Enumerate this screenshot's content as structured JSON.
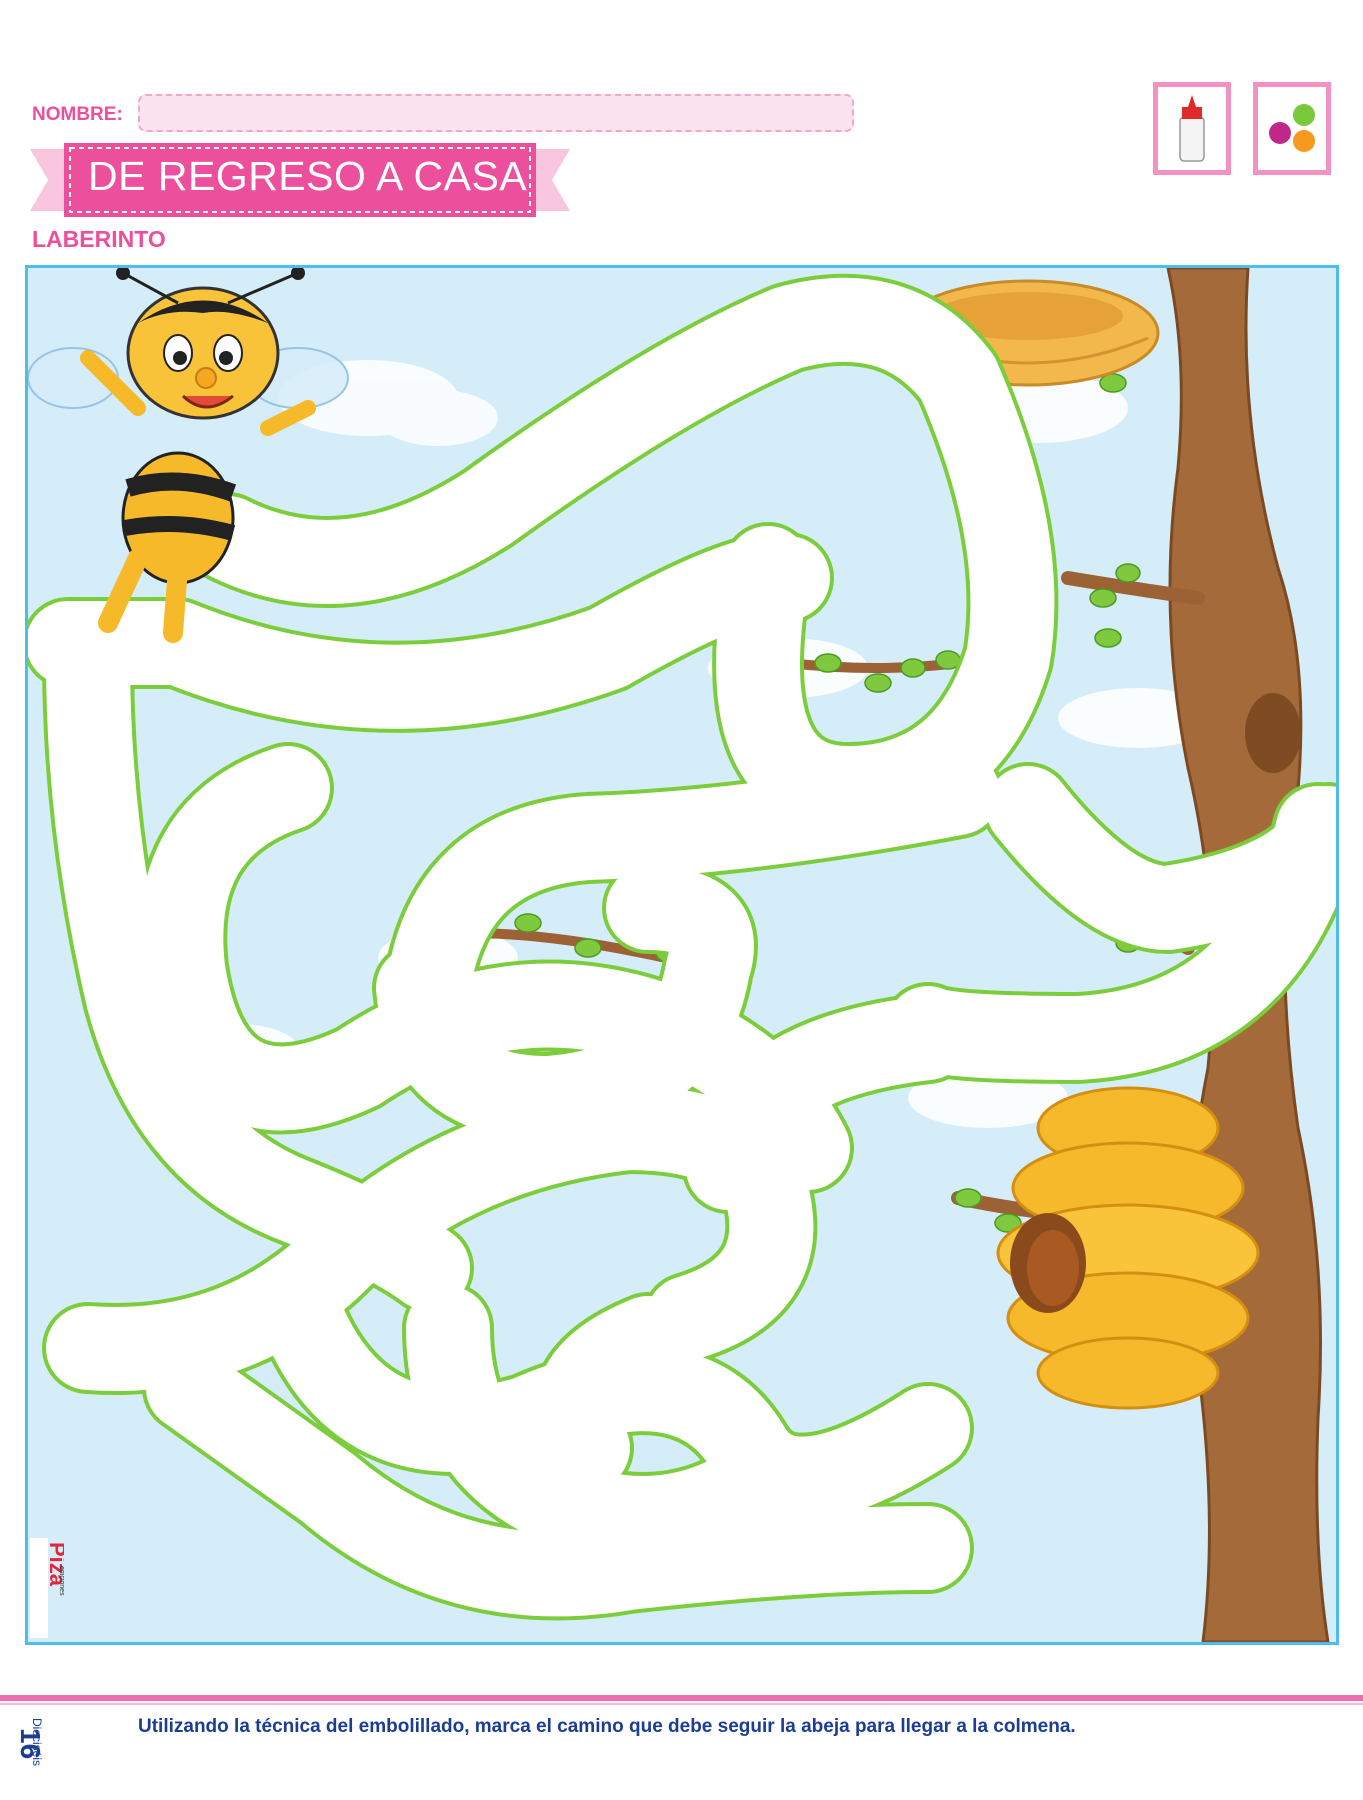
{
  "header": {
    "name_label": "NOMBRE:",
    "title": "DE REGRESO A CASA",
    "subtitle": "LABERINTO"
  },
  "materials": [
    {
      "icon": "glue-bottle-icon"
    },
    {
      "icon": "crumpled-paper-balls-icon"
    }
  ],
  "maze": {
    "start": "bee",
    "goal": "beehive",
    "path_color": "#7ccd3c",
    "sky_color": "#d5edf9"
  },
  "brand": {
    "logo_text": "Piza",
    "logo_sub": "ediciones"
  },
  "footer": {
    "page_number": "16",
    "page_word": "Dieciséis",
    "instruction": "Utilizando la técnica del embolillado, marca el camino que debe seguir la abeja para llegar a la colmena."
  },
  "colors": {
    "accent_pink": "#ec4f9c",
    "frame_blue": "#4dbde9",
    "text_blue": "#1b3d94"
  }
}
